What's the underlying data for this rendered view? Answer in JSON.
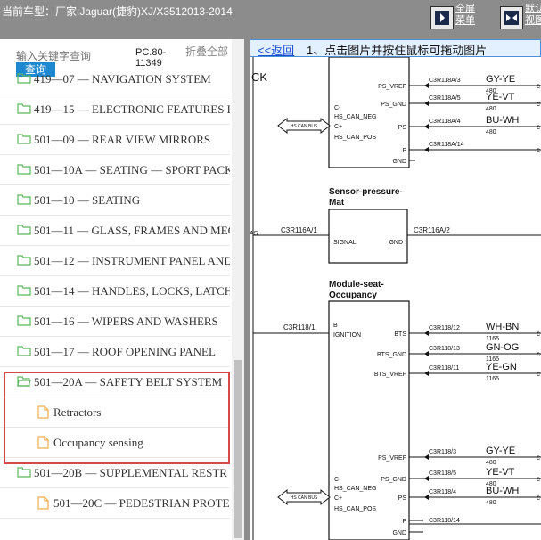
{
  "header": {
    "title": "当前车型：厂家:Jaguar(捷豹)XJ/X3512013-2014",
    "fullscreen_label": "全屏 菜单",
    "restore_label": "默认 视图"
  },
  "sidebar": {
    "search_placeholder": "输入关键字查询",
    "search_button": "查询",
    "pc_code": "PC.80-11349",
    "fold_all": "折叠全部",
    "items": [
      {
        "label": "419—07 — NAVIGATION SYSTEM",
        "type": "folder"
      },
      {
        "label": "419—15 — ELECTRONIC FEATURES P",
        "type": "folder"
      },
      {
        "label": "501—09 — REAR VIEW MIRRORS",
        "type": "folder"
      },
      {
        "label": "501—10A — SEATING — SPORT PACK",
        "type": "folder"
      },
      {
        "label": "501—10 — SEATING",
        "type": "folder"
      },
      {
        "label": "501—11 — GLASS, FRAMES AND MEC",
        "type": "folder"
      },
      {
        "label": "501—12 — INSTRUMENT PANEL AND",
        "type": "folder"
      },
      {
        "label": "501—14 — HANDLES, LOCKS, LATCH",
        "type": "folder"
      },
      {
        "label": "501—16 — WIPERS AND WASHERS",
        "type": "folder"
      },
      {
        "label": "501—17 — ROOF OPENING PANEL",
        "type": "folder"
      },
      {
        "label": "501—20A — SAFETY BELT SYSTEM",
        "type": "folder-open"
      },
      {
        "label": "Retractors",
        "type": "file"
      },
      {
        "label": "Occupancy sensing",
        "type": "file"
      },
      {
        "label": "501—20B — SUPPLEMENTAL RESTR",
        "type": "folder"
      },
      {
        "label": "501—20C — PEDESTRIAN PROTE",
        "type": "file"
      }
    ]
  },
  "content": {
    "back_link": "<<返回",
    "instruction": "1、点击图片并按住鼠标可拖动图片",
    "diagram": {
      "ck": "CK",
      "hs_can_bus": "HS CAN BUS",
      "block1_pins": [
        "C-",
        "HS_CAN_NEG",
        "C+",
        "HS_CAN_POS"
      ],
      "top_connectors": [
        {
          "pin": "PS_VREF",
          "conn": "C3R118A/3",
          "wire": "GY-YE",
          "num": "480"
        },
        {
          "pin": "PS_GND",
          "conn": "C3R118A/5",
          "wire": "YE-VT",
          "num": "480"
        },
        {
          "pin": "PS",
          "conn": "C3R118A/4",
          "wire": "BU-WH",
          "num": "480"
        },
        {
          "pin": "P",
          "conn": "C3R118A/14",
          "wire": "",
          "num": ""
        },
        {
          "pin": "GND",
          "conn": "",
          "wire": "",
          "num": ""
        }
      ],
      "sensor_title": "Sensor-pressure-Mat",
      "sensor_left_conn": "C3R116A/1",
      "sensor_signal": "SIGNAL",
      "sensor_gnd": "GND",
      "sensor_right_conn": "C3R116A/2",
      "as": "AS",
      "module_title": "Module-seat-Occupancy",
      "module_left_conn": "C3R118/1",
      "module_pin_b": "B",
      "module_ignition": "IGNITION",
      "mid_connectors": [
        {
          "pin": "BTS",
          "conn": "C3R118/12",
          "wire": "WH-BN",
          "num": "1165"
        },
        {
          "pin": "BTS_GND",
          "conn": "C3R118/13",
          "wire": "GN-OG",
          "num": "1165"
        },
        {
          "pin": "BTS_VREF",
          "conn": "C3R118/11",
          "wire": "YE-GN",
          "num": "1165"
        }
      ],
      "bottom_connectors": [
        {
          "pin": "PS_VREF",
          "conn": "C3R118/3",
          "wire": "GY-YE",
          "num": "480"
        },
        {
          "pin": "PS_GND",
          "conn": "C3R118/5",
          "wire": "YE-VT",
          "num": "480"
        },
        {
          "pin": "PS",
          "conn": "C3R118/4",
          "wire": "BU-WH",
          "num": "480"
        },
        {
          "pin": "P",
          "conn": "",
          "wire": "",
          "num": ""
        },
        {
          "pin": "GND",
          "conn": "C3R118/14",
          "wire": "",
          "num": ""
        }
      ],
      "block2_pins": [
        "C-",
        "HS_CAN_NEG",
        "C+",
        "HS_CAN_POS"
      ],
      "edge_c": "c"
    }
  },
  "colors": {
    "toolbar": "#8c8c8c",
    "highlight": "#d94848",
    "folder": "#5cb85c",
    "file": "#f0ad4e",
    "link": "#1a4fd0",
    "button": "#1e88d0"
  }
}
